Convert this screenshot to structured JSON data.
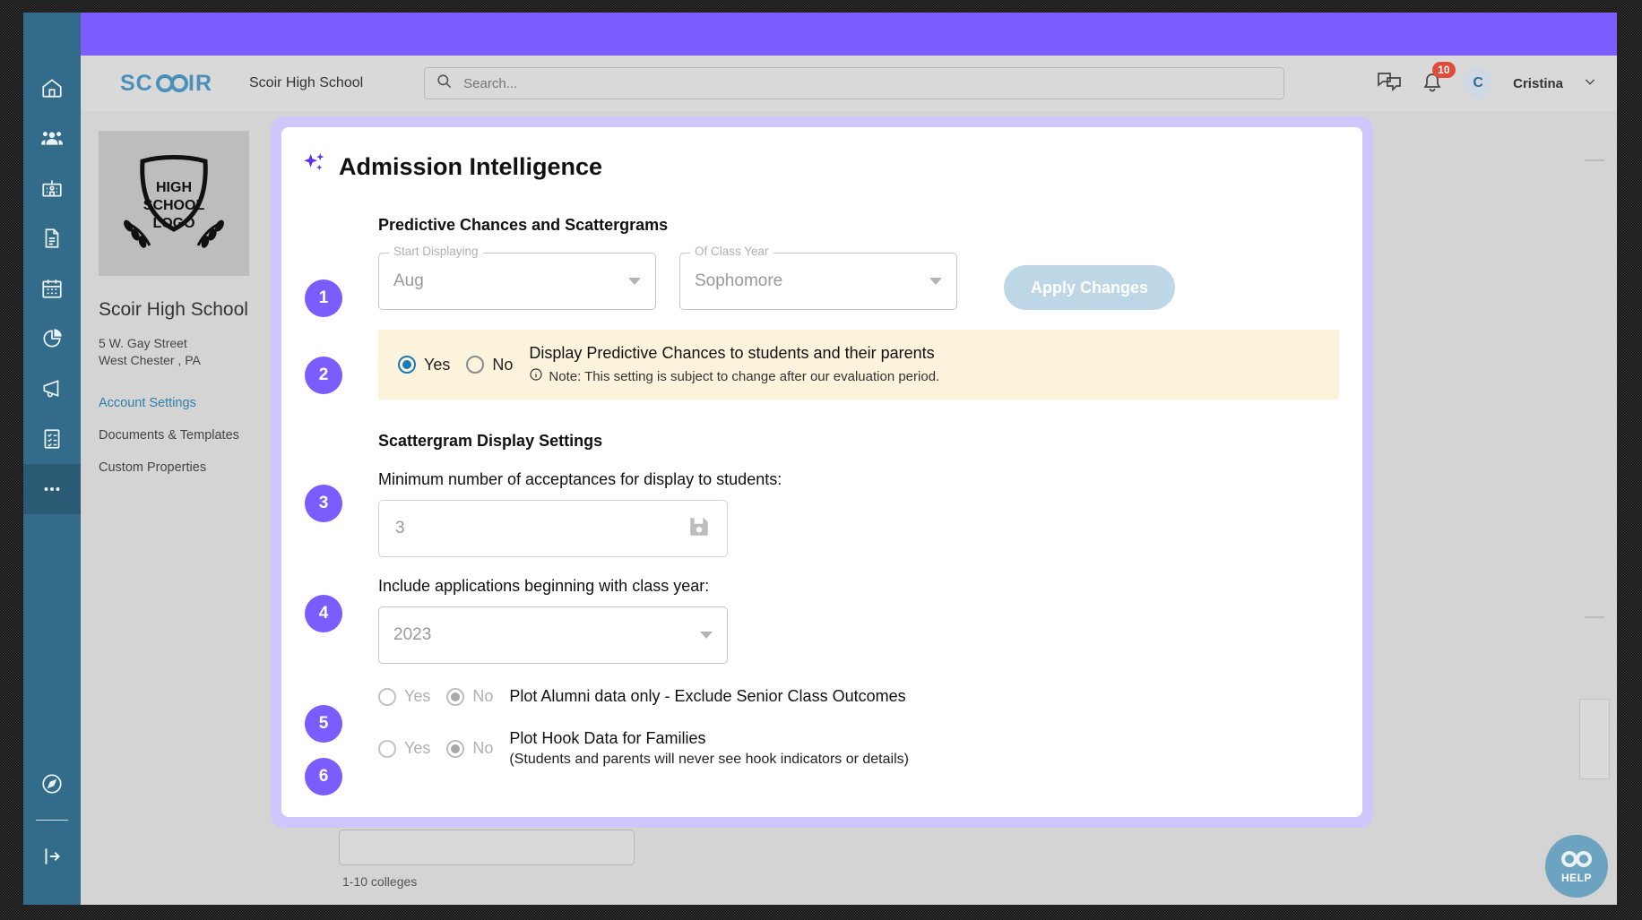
{
  "header": {
    "logo_text": "SCOIR",
    "school_name": "Scoir High School",
    "search_placeholder": "Search...",
    "notification_count": "10",
    "avatar_initial": "C",
    "user_name": "Cristina"
  },
  "sidebar_rail": {
    "items": [
      {
        "icon": "home-icon",
        "name": "home"
      },
      {
        "icon": "people-icon",
        "name": "students"
      },
      {
        "icon": "school-icon",
        "name": "colleges"
      },
      {
        "icon": "document-icon",
        "name": "documents"
      },
      {
        "icon": "calendar-icon",
        "name": "calendar"
      },
      {
        "icon": "pie-chart-icon",
        "name": "reports"
      },
      {
        "icon": "megaphone-icon",
        "name": "announcements"
      },
      {
        "icon": "checklist-icon",
        "name": "tasks"
      },
      {
        "icon": "more-icon",
        "name": "more"
      }
    ],
    "bottom": [
      {
        "icon": "compass-icon",
        "name": "explore"
      },
      {
        "icon": "logout-icon",
        "name": "collapse"
      }
    ]
  },
  "left_panel": {
    "crest_line1": "HIGH",
    "crest_line2": "SCHOOL",
    "crest_line3": "LOGO",
    "title": "Scoir High School",
    "address_line1": "5 W. Gay Street",
    "address_line2": "West Chester , PA",
    "links": [
      {
        "label": "Account Settings",
        "active": true
      },
      {
        "label": "Documents & Templates",
        "active": false
      },
      {
        "label": "Custom Properties",
        "active": false
      }
    ]
  },
  "background": {
    "colleges_text": "1-10 colleges"
  },
  "modal": {
    "title": "Admission Intelligence",
    "sparkle_color": "#5b32e8",
    "accent_color": "#7b5cff",
    "section1_head": "Predictive Chances and Scattergrams",
    "step1": {
      "number": "1",
      "start_displaying_label": "Start Displaying",
      "start_displaying_value": "Aug",
      "class_year_label": "Of Class Year",
      "class_year_value": "Sophomore",
      "apply_button": "Apply Changes"
    },
    "step2": {
      "number": "2",
      "yes_label": "Yes",
      "no_label": "No",
      "selected": "Yes",
      "text": "Display Predictive Chances to students and their parents",
      "note": "Note: This setting is subject to change after our evaluation period."
    },
    "section2_head": "Scattergram Display Settings",
    "step3": {
      "number": "3",
      "question": "Minimum number of acceptances for display to students:",
      "value": "3",
      "save_icon": "save-icon"
    },
    "step4": {
      "number": "4",
      "question": "Include applications beginning with class year:",
      "value": "2023"
    },
    "step5": {
      "number": "5",
      "yes_label": "Yes",
      "no_label": "No",
      "selected": "No",
      "text": "Plot Alumni data only - Exclude Senior Class Outcomes"
    },
    "step6": {
      "number": "6",
      "yes_label": "Yes",
      "no_label": "No",
      "selected": "No",
      "text": "Plot Hook Data for Families",
      "subtext": "(Students and parents will never see hook indicators or details)"
    }
  },
  "help": {
    "label": "HELP"
  }
}
